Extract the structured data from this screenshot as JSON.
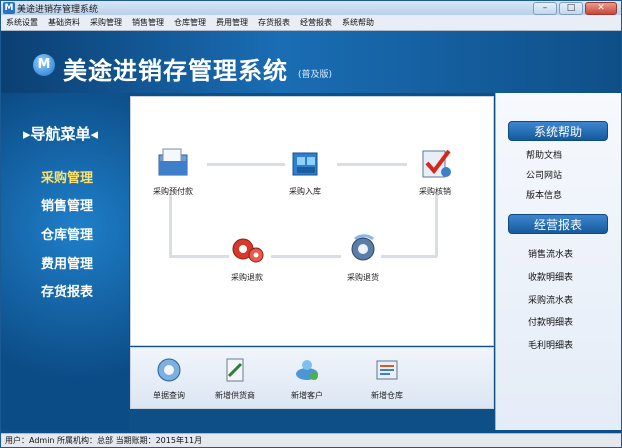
{
  "window": {
    "title": "美途进销存管理系统",
    "min_label": "–",
    "max_label": "□",
    "close_label": "✕"
  },
  "menu": [
    "系统设置",
    "基础资料",
    "采购管理",
    "销售管理",
    "仓库管理",
    "费用管理",
    "存货报表",
    "经营报表",
    "系统帮助"
  ],
  "banner": {
    "logo_letter": "M",
    "title": "美途进销存管理系统",
    "edition": "(普及版)"
  },
  "nav": {
    "heading": "▸导航菜单◂",
    "items": [
      "采购管理",
      "销售管理",
      "仓库管理",
      "费用管理",
      "存货报表"
    ],
    "active": "采购管理"
  },
  "flow": {
    "prepay": "采购预付款",
    "stock_in": "采购入库",
    "verify": "采购核销",
    "refund": "采购退款",
    "return": "采购退货"
  },
  "quick": [
    "单据查询",
    "新增供货商",
    "新增客户",
    "新增仓库"
  ],
  "right": {
    "help_title": "系统帮助",
    "help_links": [
      "帮助文档",
      "公司网站",
      "版本信息"
    ],
    "report_title": "经营报表",
    "report_links": [
      "销售流水表",
      "收款明细表",
      "采购流水表",
      "付款明细表",
      "毛利明细表"
    ]
  },
  "status": "用户：Admin  所属机构：总部  当期账期：2015年11月",
  "colors": {
    "banner": "#0f4f88",
    "active_nav": "#ffe16a",
    "section_head": "#1f6db3"
  }
}
